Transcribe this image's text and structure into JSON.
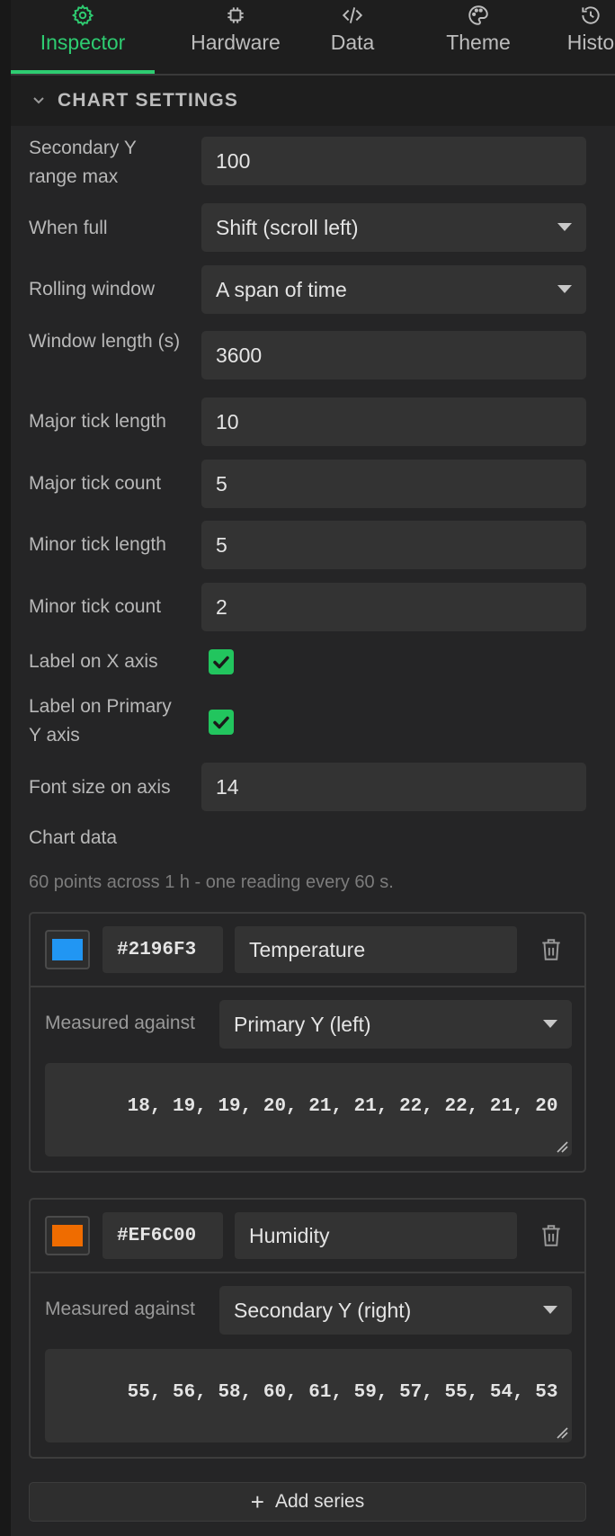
{
  "tabs": [
    {
      "label": "Inspector",
      "icon": "gear-icon",
      "active": true
    },
    {
      "label": "Hardware",
      "icon": "chip-icon"
    },
    {
      "label": "Data",
      "icon": "code-icon"
    },
    {
      "label": "Theme",
      "icon": "palette-icon"
    },
    {
      "label": "Histo",
      "icon": "history-icon"
    }
  ],
  "section": {
    "title": "CHART SETTINGS",
    "icon": "chevron-down-icon"
  },
  "settings": {
    "secondary_y_max": {
      "label": "Secondary Y range max",
      "value": "100"
    },
    "when_full": {
      "label": "When full",
      "value": "Shift (scroll left)"
    },
    "rolling_window": {
      "label": "Rolling window",
      "value": "A span of time"
    },
    "window_length": {
      "label": "Window length (s)",
      "value": "3600"
    },
    "major_tick_length": {
      "label": "Major tick length",
      "value": "10"
    },
    "major_tick_count": {
      "label": "Major tick count",
      "value": "5"
    },
    "minor_tick_length": {
      "label": "Minor tick length",
      "value": "5"
    },
    "minor_tick_count": {
      "label": "Minor tick count",
      "value": "2"
    },
    "label_x_axis": {
      "label": "Label on X axis",
      "checked": true
    },
    "label_primary_y": {
      "label": "Label on Primary Y axis",
      "checked": true
    },
    "font_size_axis": {
      "label": "Font size on axis",
      "value": "14"
    }
  },
  "chart_data_section": {
    "label": "Chart data",
    "summary": "60 points across 1 h - one reading every 60 s."
  },
  "series": [
    {
      "color": "#2196F3",
      "hex": "#2196F3",
      "name": "Temperature",
      "measured_label": "Measured against",
      "axis": "Primary Y (left)",
      "values": "18, 19, 19, 20, 21, 21, 22, 22, 21, 20"
    },
    {
      "color": "#EF6C00",
      "hex": "#EF6C00",
      "name": "Humidity",
      "measured_label": "Measured against",
      "axis": "Secondary Y (right)",
      "values": "55, 56, 58, 60, 61, 59, 57, 55, 54, 53"
    }
  ],
  "add_series_label": "Add series",
  "colors": {
    "accent": "#2ecc71",
    "checkbox": "#22c55e"
  }
}
